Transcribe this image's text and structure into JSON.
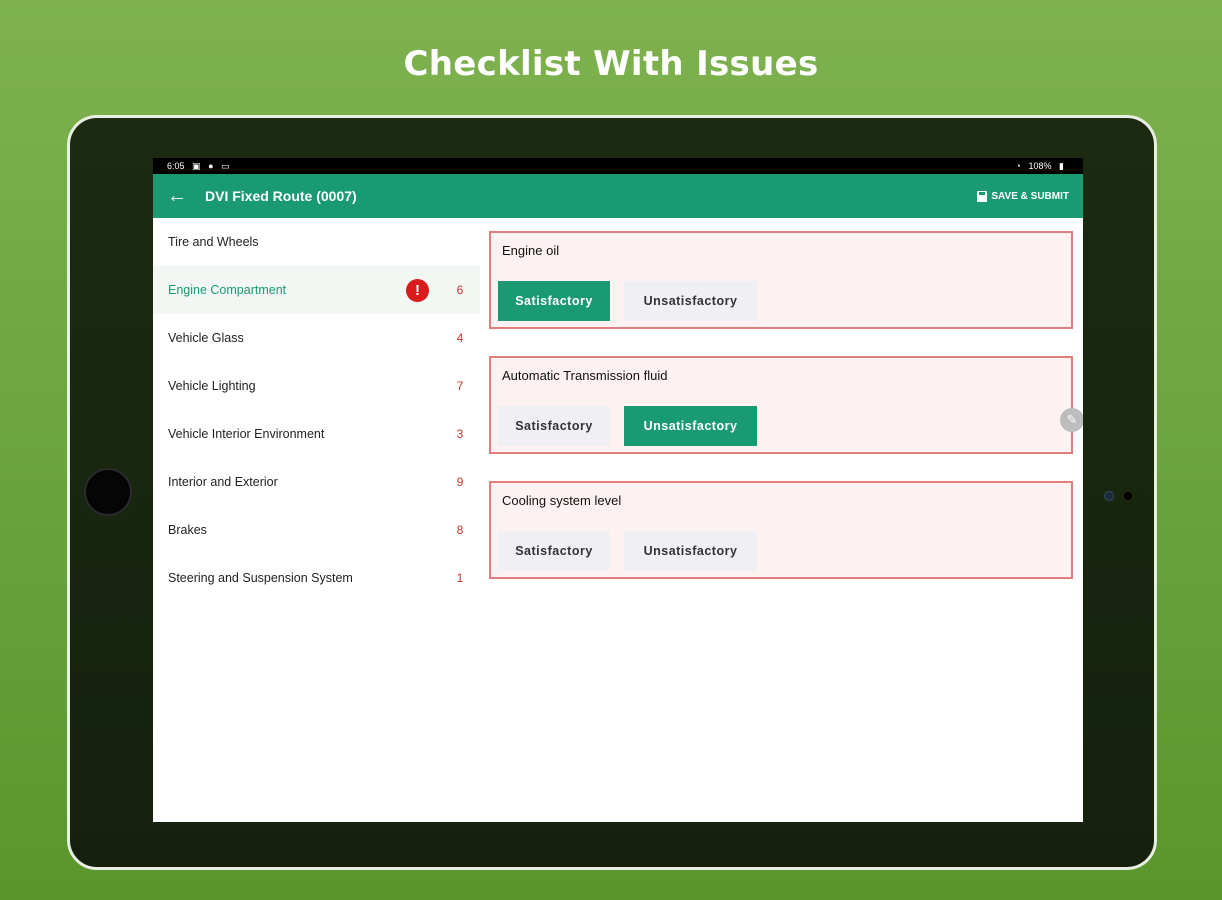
{
  "headline": "Checklist With Issues",
  "status_bar": {
    "time": "6:05",
    "left_icons": [
      "image-icon",
      "location-icon",
      "cast-icon"
    ],
    "right_text": "108%"
  },
  "app_bar": {
    "title": "DVI Fixed Route (0007)",
    "save_label": "SAVE & SUBMIT"
  },
  "sidebar": {
    "categories": [
      {
        "label": "Tire and Wheels",
        "count": ""
      },
      {
        "label": "Engine Compartment",
        "count": "6",
        "active": true,
        "alert": "!"
      },
      {
        "label": "Vehicle Glass",
        "count": "4"
      },
      {
        "label": "Vehicle Lighting",
        "count": "7"
      },
      {
        "label": "Vehicle Interior Environment",
        "count": "3"
      },
      {
        "label": "Interior and Exterior",
        "count": "9"
      },
      {
        "label": "Brakes",
        "count": "8"
      },
      {
        "label": "Steering and Suspension System",
        "count": "1"
      }
    ]
  },
  "checklist": {
    "options": {
      "satisfactory": "Satisfactory",
      "unsatisfactory": "Unsatisfactory"
    },
    "items": [
      {
        "title": "Engine oil",
        "selected": "satisfactory"
      },
      {
        "title": "Automatic Transmission fluid",
        "selected": "unsatisfactory"
      },
      {
        "title": "Cooling system level",
        "selected": "none"
      }
    ]
  },
  "colors": {
    "accent": "#1a9a72",
    "issue_border": "#e07e7e",
    "issue_bg": "#fdf1f1",
    "alert": "#d81b1b"
  }
}
